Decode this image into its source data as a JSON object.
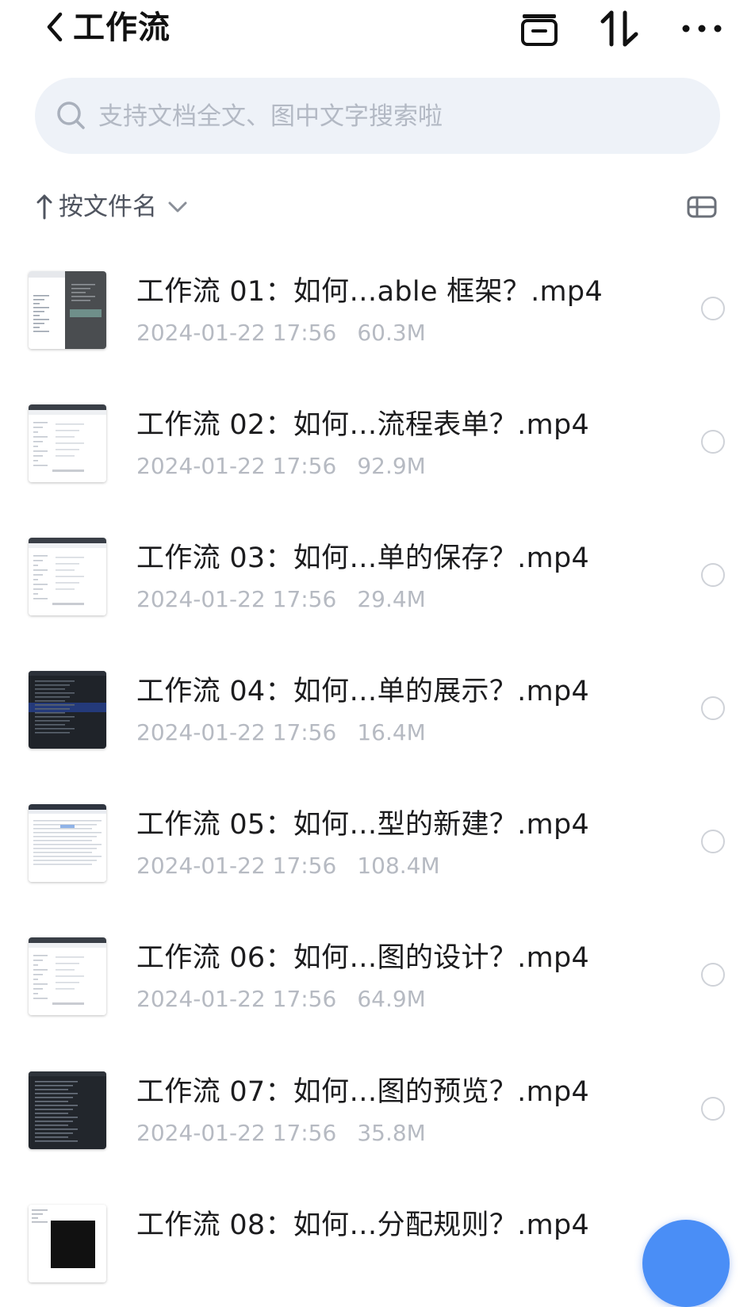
{
  "header": {
    "title": "工作流",
    "back_icon": "chevron-left-icon",
    "actions": [
      "archive-icon",
      "sort-updown-icon",
      "more-horizontal-icon"
    ]
  },
  "search": {
    "placeholder": "支持文档全文、图中文字搜索啦"
  },
  "sort": {
    "label": "按文件名",
    "direction_icon": "arrow-up-icon",
    "view_icon": "layout-list-icon"
  },
  "files": [
    {
      "name": "工作流 01：如何…able 框架？.mp4",
      "date": "2024-01-22 17:56",
      "size": "60.3M",
      "thumb": "split-dark"
    },
    {
      "name": "工作流 02：如何…流程表单？.mp4",
      "date": "2024-01-22 17:56",
      "size": "92.9M",
      "thumb": "light"
    },
    {
      "name": "工作流 03：如何…单的保存？.mp4",
      "date": "2024-01-22 17:56",
      "size": "29.4M",
      "thumb": "light"
    },
    {
      "name": "工作流 04：如何…单的展示？.mp4",
      "date": "2024-01-22 17:56",
      "size": "16.4M",
      "thumb": "code-blue"
    },
    {
      "name": "工作流 05：如何…型的新建？.mp4",
      "date": "2024-01-22 17:56",
      "size": "108.4M",
      "thumb": "light-table"
    },
    {
      "name": "工作流 06：如何…图的设计？.mp4",
      "date": "2024-01-22 17:56",
      "size": "64.9M",
      "thumb": "light"
    },
    {
      "name": "工作流 07：如何…图的预览？.mp4",
      "date": "2024-01-22 17:56",
      "size": "35.8M",
      "thumb": "code"
    },
    {
      "name": "工作流 08：如何…分配规则？.mp4",
      "date": "",
      "size": "",
      "thumb": "light-black"
    }
  ],
  "colors": {
    "search_bg": "#eef2f8",
    "meta_text": "#b6bac2",
    "fab": "#4a8ef6"
  }
}
